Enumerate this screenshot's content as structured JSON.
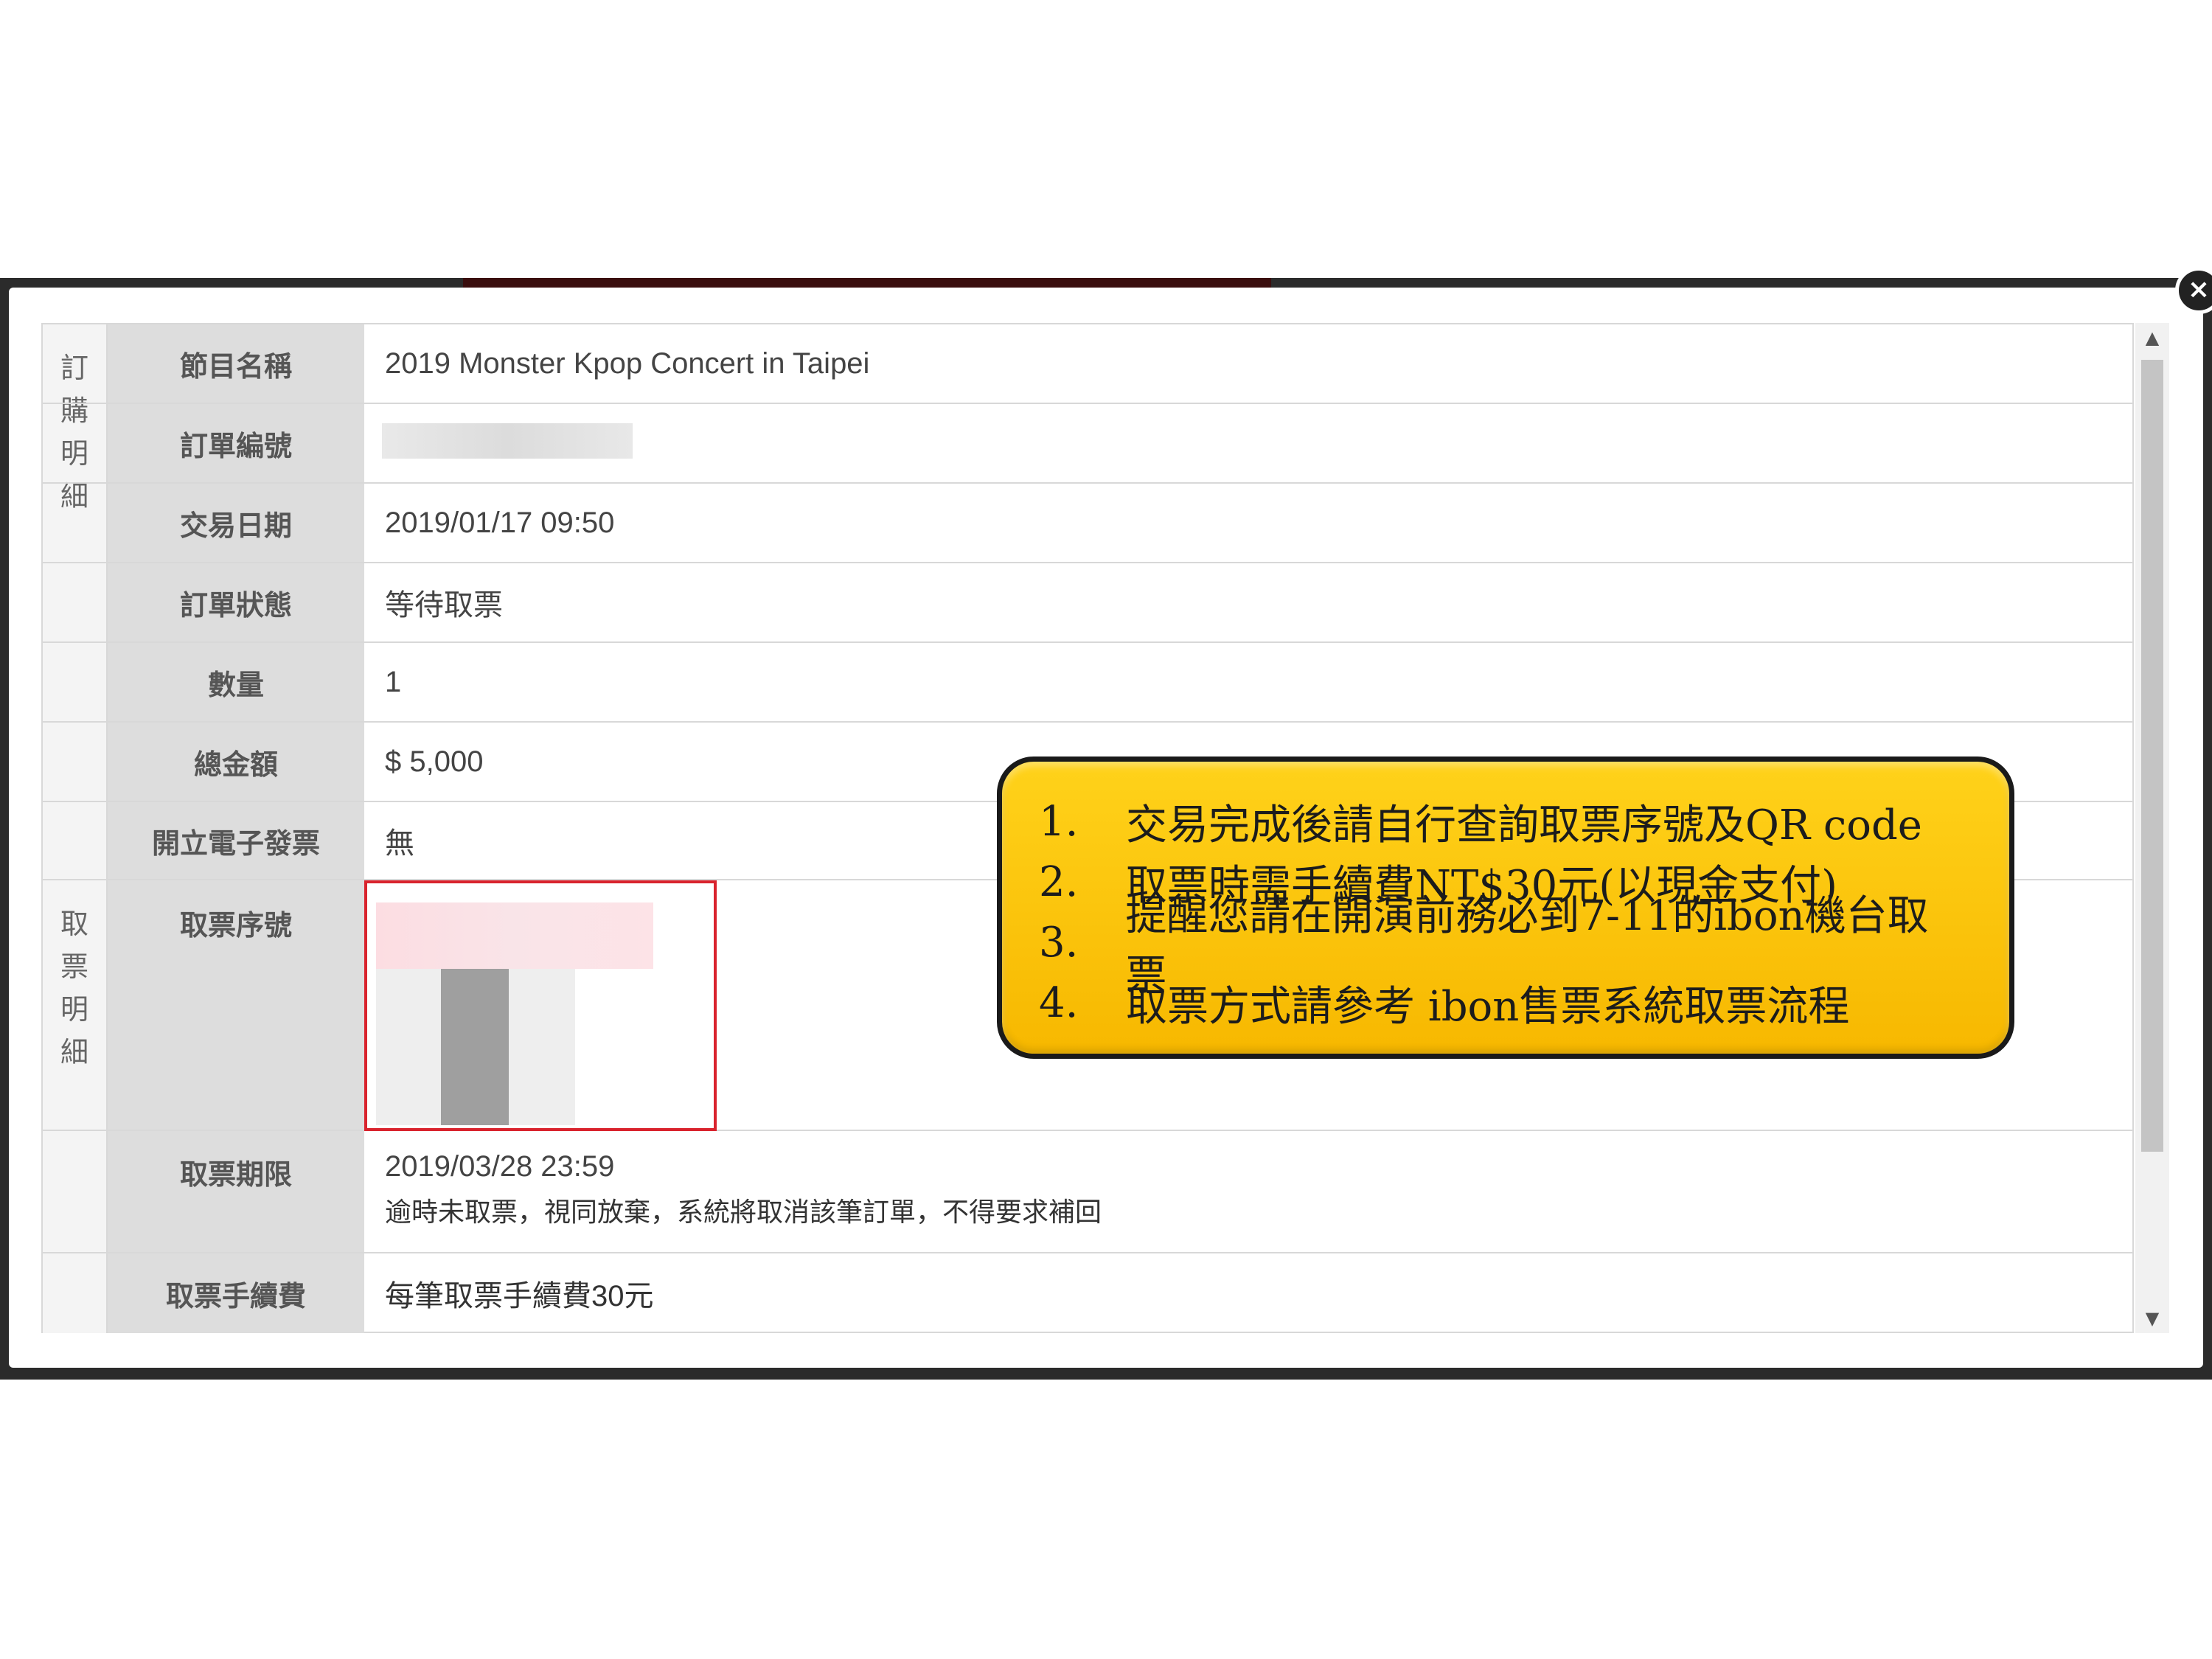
{
  "modal": {
    "close_icon": "×",
    "group_order": {
      "label_chars": [
        "訂",
        "購",
        "明",
        "細"
      ]
    },
    "group_ticket": {
      "label_chars": [
        "取",
        "票",
        "明",
        "細"
      ]
    },
    "rows": {
      "program_name": {
        "label": "節目名稱",
        "value": "2019 Monster Kpop Concert in Taipei"
      },
      "order_number": {
        "label": "訂單編號",
        "value": ""
      },
      "transaction_date": {
        "label": "交易日期",
        "value": "2019/01/17 09:50"
      },
      "order_status": {
        "label": "訂單狀態",
        "value": "等待取票"
      },
      "quantity": {
        "label": "數量",
        "value": "1"
      },
      "total_amount": {
        "label": "總金額",
        "value": "$ 5,000"
      },
      "e_invoice": {
        "label": "開立電子發票",
        "value": "無"
      },
      "pickup_serial": {
        "label": "取票序號",
        "value": ""
      },
      "pickup_deadline": {
        "label": "取票期限",
        "value": "2019/03/28 23:59",
        "note": "逾時未取票，視同放棄，系統將取消該筆訂單，不得要求補回"
      },
      "pickup_fee": {
        "label": "取票手續費",
        "value": "每筆取票手續費30元"
      }
    }
  },
  "callout": {
    "items": [
      {
        "num": "1.",
        "text": "交易完成後請自行查詢取票序號及QR code"
      },
      {
        "num": "2.",
        "text": "取票時需手續費NT$30元(以現金支付)"
      },
      {
        "num": "3.",
        "text": "提醒您請在開演前務必到7-11的ibon機台取票"
      },
      {
        "num": "4.",
        "text": "取票方式請參考 ibon售票系統取票流程"
      }
    ]
  },
  "colors": {
    "highlight_border": "#d9232d",
    "callout_fill": "#ffcc00",
    "label_bg": "#dddddd"
  }
}
